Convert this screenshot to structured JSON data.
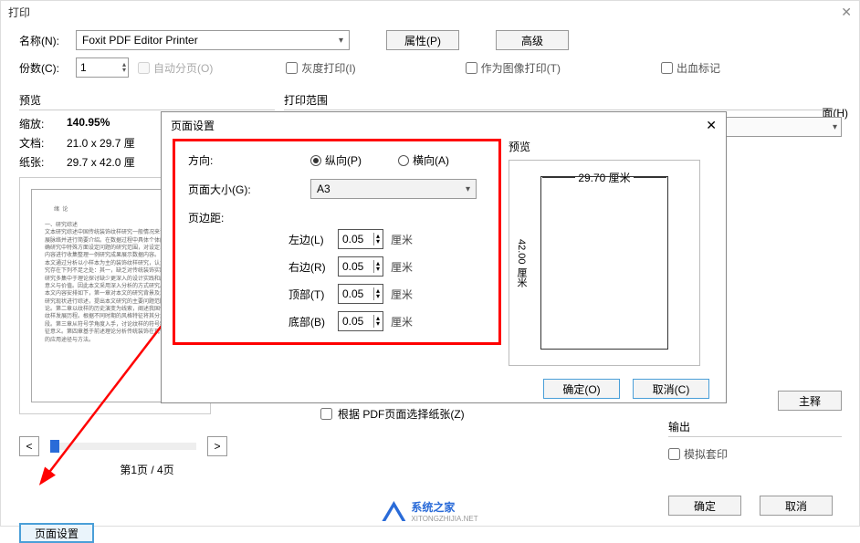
{
  "main": {
    "title": "打印",
    "name_label": "名称(N):",
    "printer": "Foxit PDF Editor Printer",
    "properties_btn": "属性(P)",
    "advanced_btn": "高级",
    "copies_label": "份数(C):",
    "copies_value": "1",
    "collate": "自动分页(O)",
    "grayscale": "灰度打印(I)",
    "asimage": "作为图像打印(T)",
    "bleed": "出血标记"
  },
  "preview": {
    "title": "预览",
    "zoom_label": "缩放:",
    "zoom_value": "140.95%",
    "doc_label": "文档:",
    "doc_value": "21.0 x 29.7 厘",
    "paper_label": "纸张:",
    "paper_value": "29.7 x 42.0 厘",
    "page_indicator": "第1页 / 4页"
  },
  "range": {
    "title": "打印范围",
    "double_side": "面(H)",
    "auto_paper": "根据 PDF页面选择纸张(Z)",
    "annotations_btn": "主释",
    "output_title": "输出",
    "simulate": "模拟套印"
  },
  "page_setup_btn": "页面设置",
  "footer": {
    "ok": "确定",
    "cancel": "取消"
  },
  "watermark": {
    "name": "系统之家",
    "url": "XITONGZHIJIA.NET"
  },
  "modal": {
    "title": "页面设置",
    "orientation_label": "方向:",
    "portrait": "纵向(P)",
    "landscape": "横向(A)",
    "size_label": "页面大小(G):",
    "size_value": "A3",
    "margin_label": "页边距:",
    "left": "左边(L)",
    "right": "右边(R)",
    "top": "顶部(T)",
    "bottom": "底部(B)",
    "margin_value": "0.05",
    "unit": "厘米",
    "preview_label": "预览",
    "width_dim": "29.70 厘米",
    "height_dim": "42.00 厘米",
    "ok": "确定(O)",
    "cancel": "取消(C)"
  }
}
